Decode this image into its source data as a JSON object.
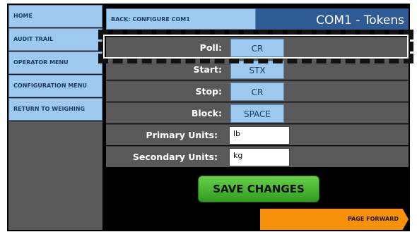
{
  "sidebar": {
    "items": [
      {
        "label": "HOME"
      },
      {
        "label": "AUDIT TRAIL"
      },
      {
        "label": "OPERATOR MENU"
      },
      {
        "label": "CONFIGURATION MENU"
      },
      {
        "label": "RETURN TO WEIGHING"
      }
    ]
  },
  "header": {
    "back_label": "BACK: CONFIGURE COM1",
    "title": "COM1 - Tokens"
  },
  "fields": {
    "poll": {
      "label": "Poll:",
      "value": "CR"
    },
    "start": {
      "label": "Start:",
      "value": "STX"
    },
    "stop": {
      "label": "Stop:",
      "value": "CR"
    },
    "block": {
      "label": "Block:",
      "value": "SPACE"
    },
    "primary_units": {
      "label": "Primary Units:",
      "value": "lb"
    },
    "secondary_units": {
      "label": "Secondary Units:",
      "value": "kg"
    }
  },
  "actions": {
    "save_label": "SAVE CHANGES",
    "page_forward_label": "PAGE FORWARD"
  },
  "colors": {
    "nav_button": "#9ec9ee",
    "title_bar": "#2e5b93",
    "row_background": "#595959",
    "save_button": "#3fb52a",
    "page_forward": "#f7900a"
  }
}
